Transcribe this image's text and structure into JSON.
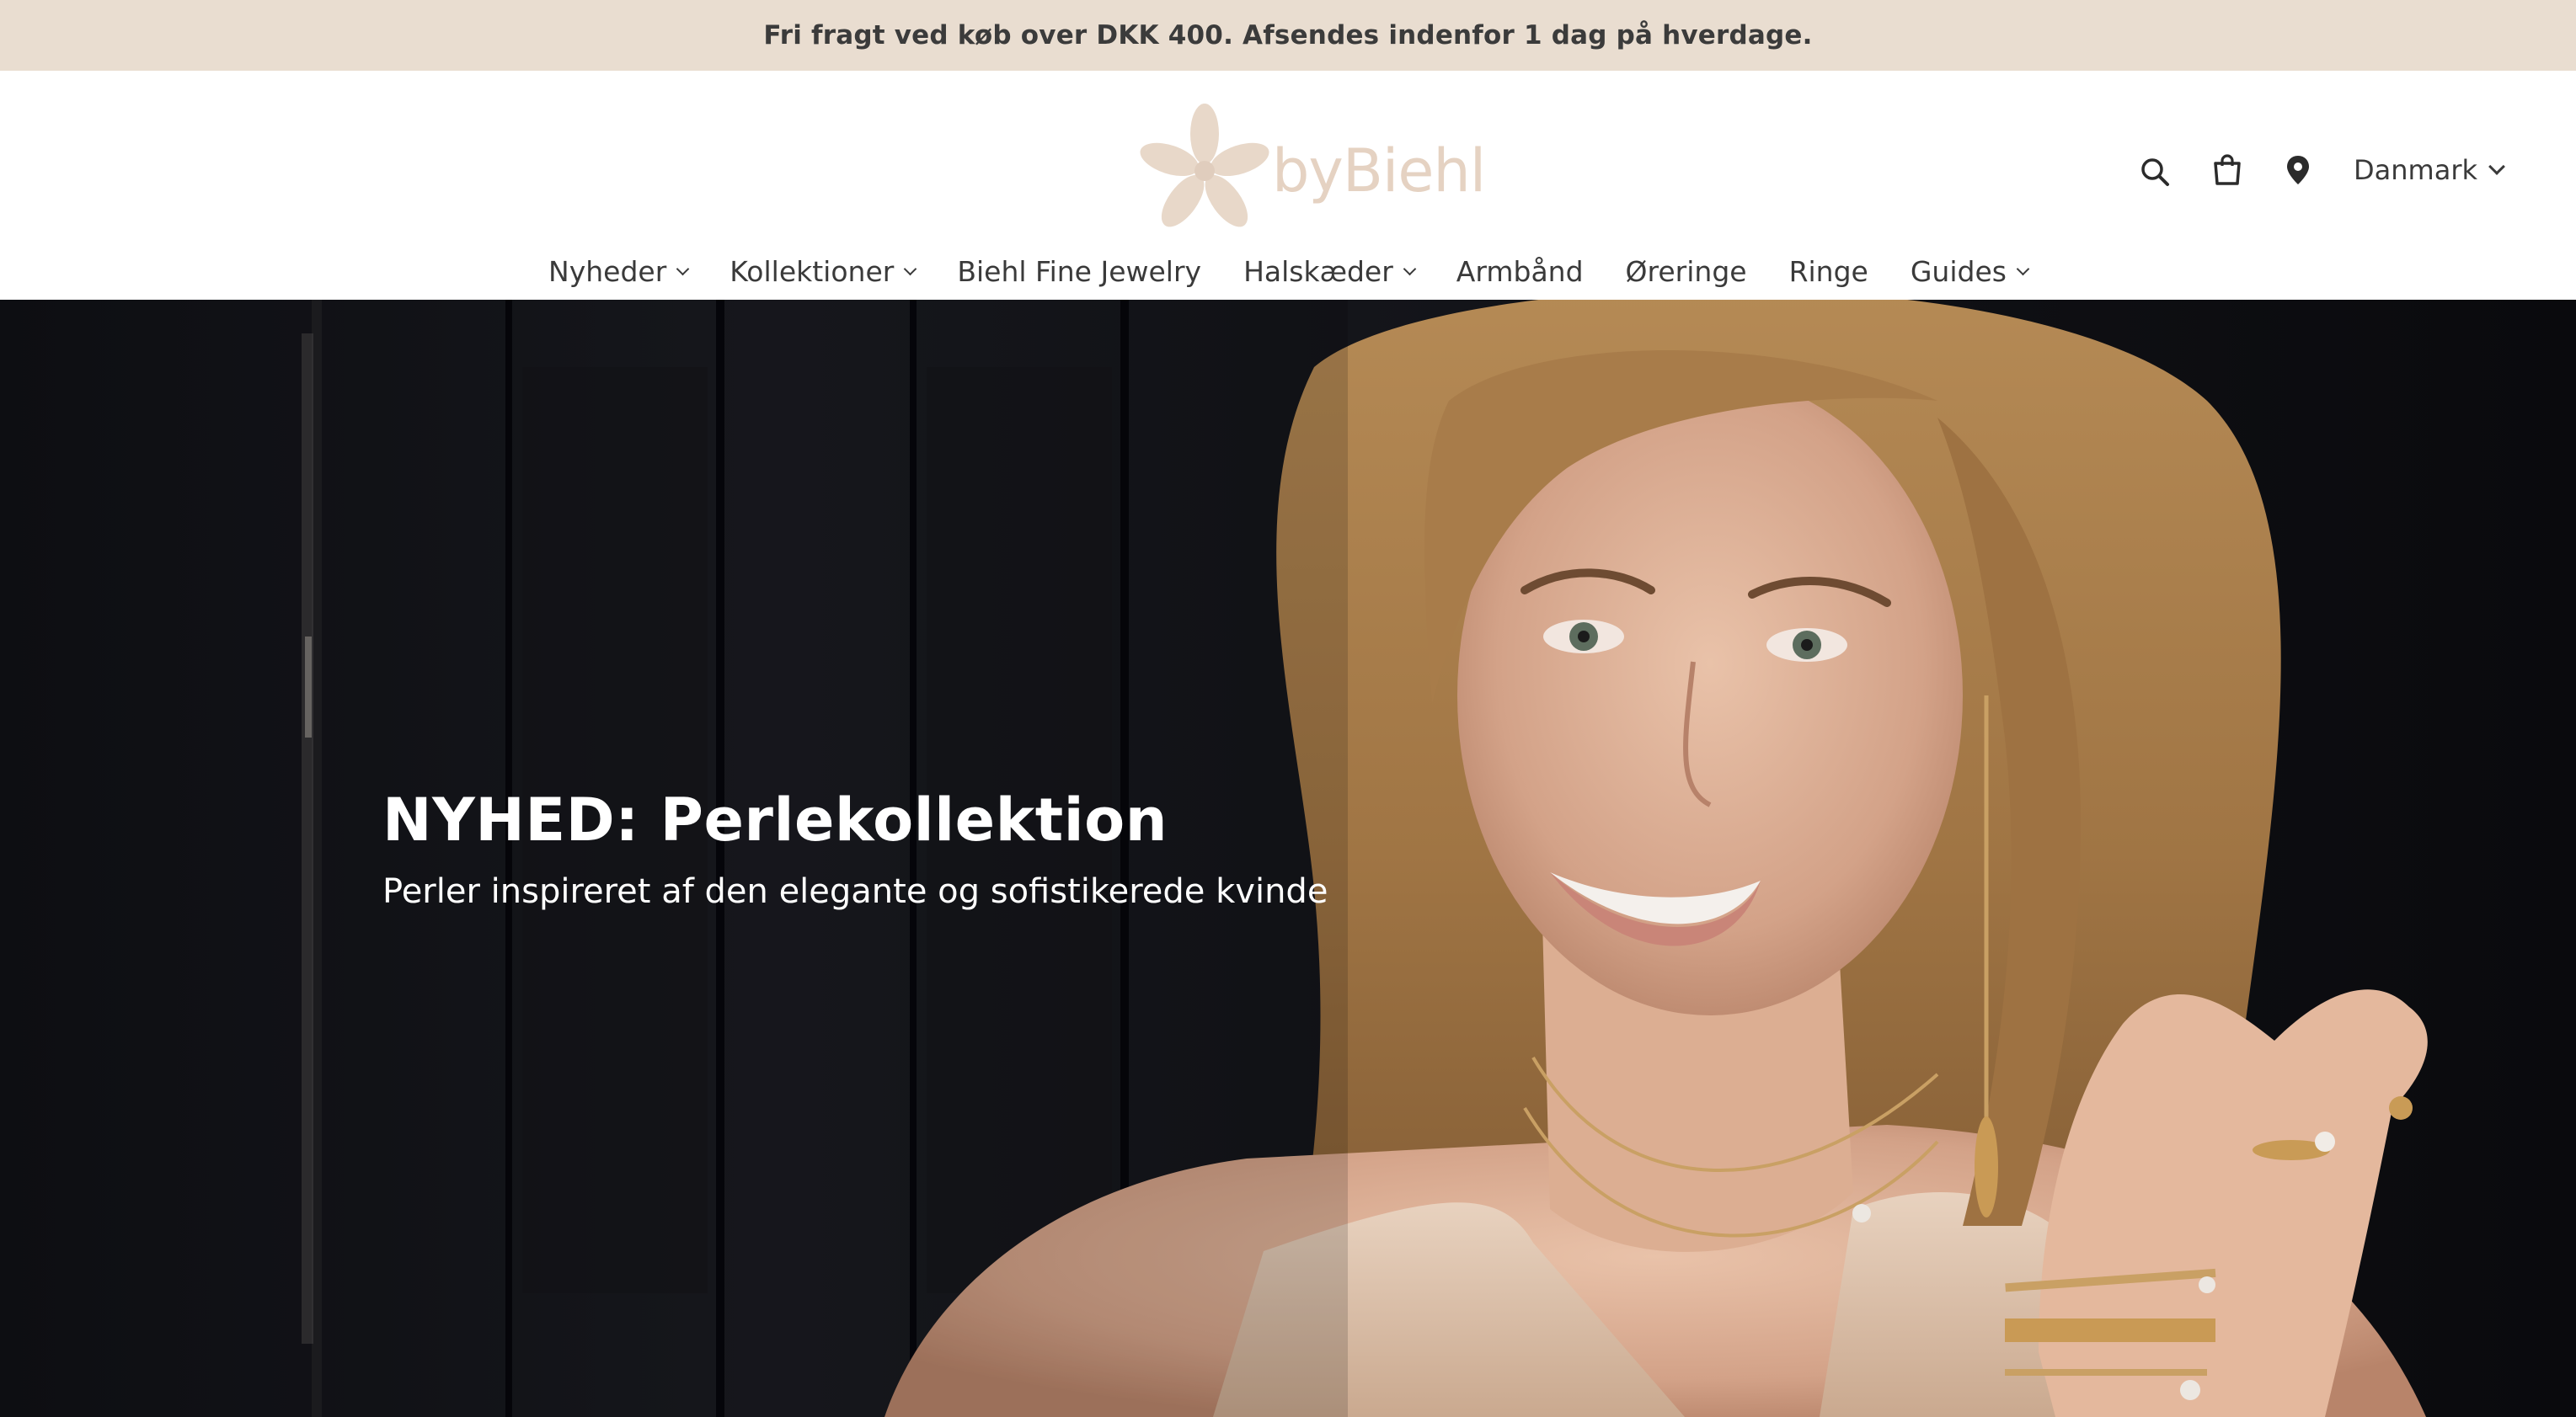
{
  "announcement": {
    "text": "Fri fragt ved køb over DKK 400. Afsendes indenfor 1 dag på hverdage."
  },
  "header": {
    "logo_text": "byBiehl",
    "logo_icon": "flower-icon",
    "icons": [
      "search-icon",
      "cart-icon",
      "location-pin-icon"
    ],
    "country": "Danmark"
  },
  "nav": {
    "items": [
      {
        "label": "Nyheder",
        "has_dropdown": true
      },
      {
        "label": "Kollektioner",
        "has_dropdown": true
      },
      {
        "label": "Biehl Fine Jewelry",
        "has_dropdown": false
      },
      {
        "label": "Halskæder",
        "has_dropdown": true
      },
      {
        "label": "Armbånd",
        "has_dropdown": false
      },
      {
        "label": "Øreringe",
        "has_dropdown": false
      },
      {
        "label": "Ringe",
        "has_dropdown": false
      },
      {
        "label": "Guides",
        "has_dropdown": true
      }
    ]
  },
  "hero": {
    "title": "NYHED: Perlekollektion",
    "subtitle": "Perler inspireret af den elegante og sofistikerede kvinde"
  },
  "colors": {
    "announcement_bg": "#e9ddd0",
    "logo": "#e5d2c2",
    "text": "#3a3a3a",
    "hero_bg": "#0d0d10"
  }
}
